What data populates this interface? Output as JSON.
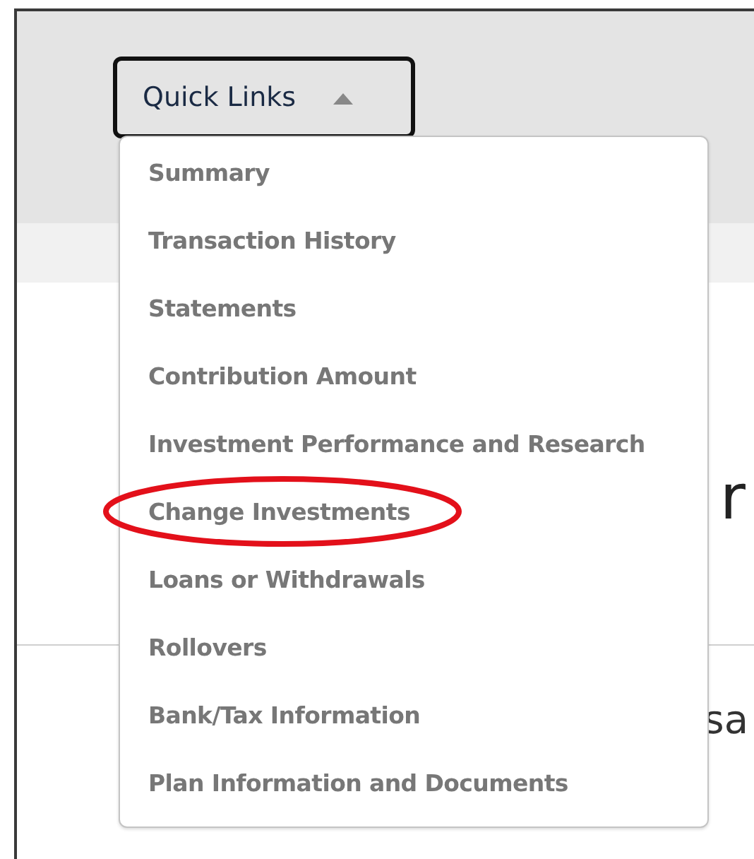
{
  "quick_links": {
    "label": "Quick Links",
    "expanded": true,
    "items": [
      {
        "label": "Summary",
        "circled": false
      },
      {
        "label": "Transaction History",
        "circled": false
      },
      {
        "label": "Statements",
        "circled": false
      },
      {
        "label": "Contribution Amount",
        "circled": false
      },
      {
        "label": "Investment Performance and Research",
        "circled": false
      },
      {
        "label": "Change Investments",
        "circled": true
      },
      {
        "label": "Loans or Withdrawals",
        "circled": false
      },
      {
        "label": "Rollovers",
        "circled": false
      },
      {
        "label": "Bank/Tax Information",
        "circled": false
      },
      {
        "label": "Plan Information and Documents",
        "circled": false
      }
    ]
  },
  "page": {
    "heading": "r",
    "text": "sa"
  }
}
